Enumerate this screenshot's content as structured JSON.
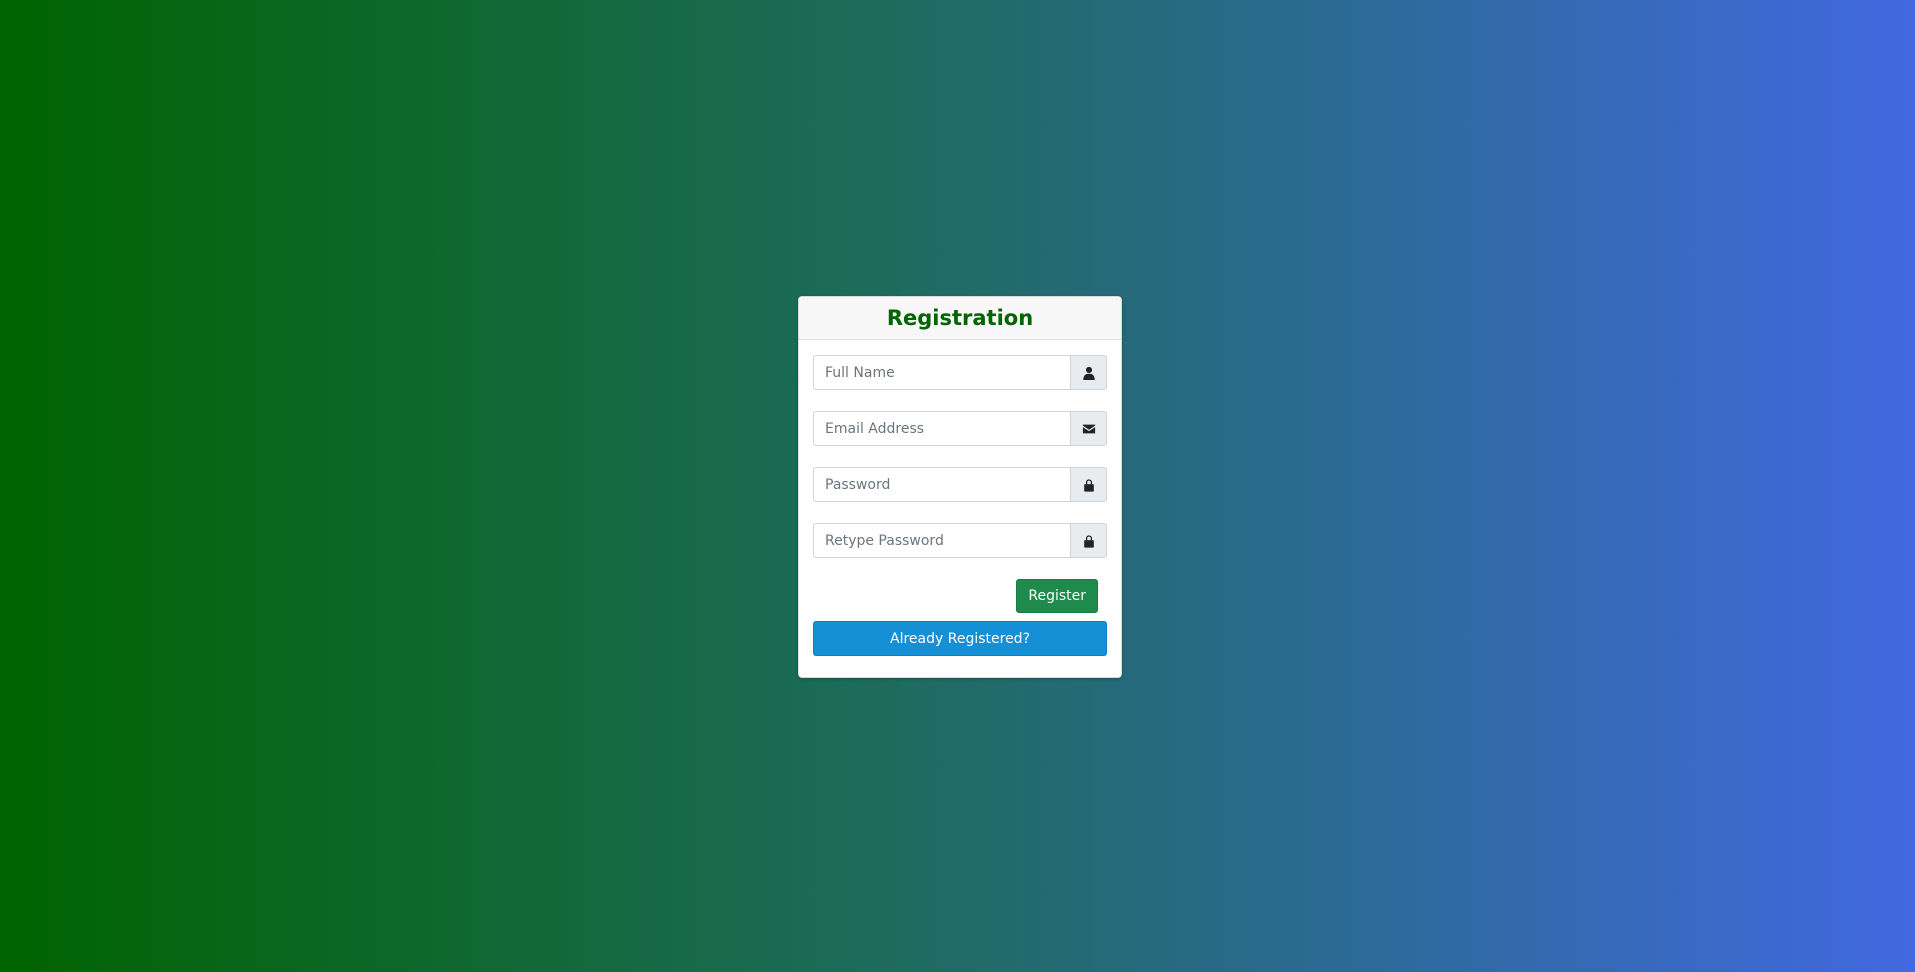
{
  "colors": {
    "gradient_start": "#006400",
    "gradient_end": "#4169e1",
    "title": "#006400",
    "register_button": "#1e8a4c",
    "login_button": "#1590d6"
  },
  "form": {
    "title": "Registration",
    "fields": [
      {
        "placeholder": "Full Name",
        "value": "",
        "icon": "user-icon"
      },
      {
        "placeholder": "Email Address",
        "value": "",
        "icon": "envelope-icon"
      },
      {
        "placeholder": "Password",
        "value": "",
        "icon": "lock-icon"
      },
      {
        "placeholder": "Retype Password",
        "value": "",
        "icon": "lock-icon"
      }
    ],
    "register_label": "Register",
    "login_label": "Already Registered?"
  }
}
